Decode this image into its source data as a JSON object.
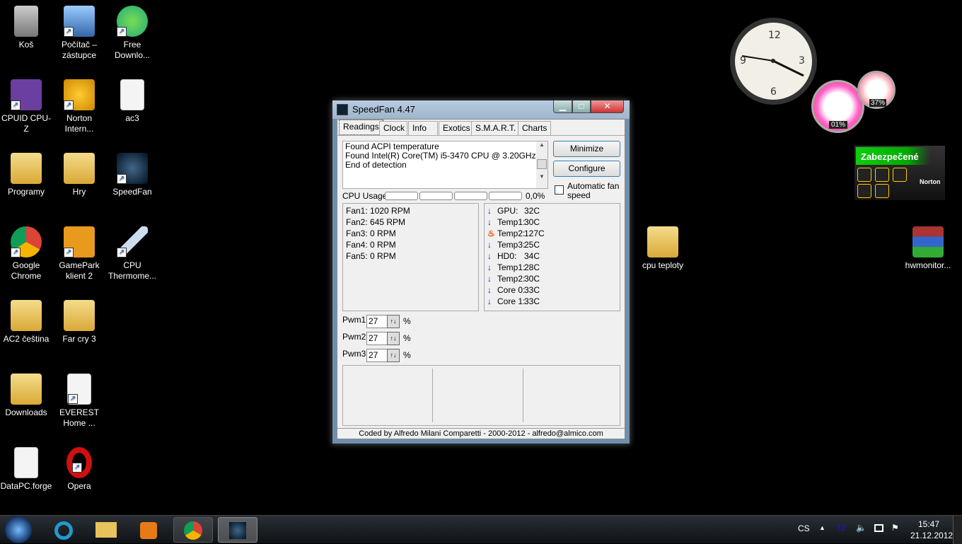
{
  "desktop_icons": [
    {
      "label": "Koš"
    },
    {
      "label": "Počítač – zástupce"
    },
    {
      "label": "Free Downlo..."
    },
    {
      "label": "CPUID CPU-Z"
    },
    {
      "label": "Norton Intern..."
    },
    {
      "label": "ac3"
    },
    {
      "label": "Programy"
    },
    {
      "label": "Hry"
    },
    {
      "label": "SpeedFan"
    },
    {
      "label": "Google Chrome"
    },
    {
      "label": "GamePark klient 2"
    },
    {
      "label": "CPU Thermome..."
    },
    {
      "label": "AC2 čeština"
    },
    {
      "label": "Far cry 3"
    },
    {
      "label": "Downloads"
    },
    {
      "label": "EVEREST Home ..."
    },
    {
      "label": "DataPC.forge"
    },
    {
      "label": "Opera"
    },
    {
      "label": "cpu teploty"
    },
    {
      "label": "hwmonitor..."
    }
  ],
  "gadgets": {
    "cpu_meter": {
      "cpu": "01%",
      "ram": "37%"
    },
    "norton": {
      "status": "Zabezpečené",
      "brand": "Norton"
    },
    "clock": {
      "hour": 15,
      "minute": 47
    }
  },
  "window": {
    "title": "SpeedFan 4.47",
    "tabs": [
      "Readings",
      "Clock",
      "Info",
      "Exotics",
      "S.M.A.R.T.",
      "Charts"
    ],
    "log": [
      "Found ACPI temperature",
      "Found Intel(R) Core(TM) i5-3470 CPU @ 3.20GHz",
      "End of detection"
    ],
    "minimize": "Minimize",
    "configure": "Configure",
    "auto_fan": "Automatic fan speed",
    "cpu_usage_label": "CPU Usage",
    "cpu_usage_value": "0,0%",
    "fans": [
      "Fan1: 1020 RPM",
      "Fan2: 645 RPM",
      "Fan3: 0 RPM",
      "Fan4: 0 RPM",
      "Fan5: 0 RPM"
    ],
    "temps": [
      {
        "name": "GPU:",
        "value": "32C",
        "icon": "down"
      },
      {
        "name": "Temp1:",
        "value": "30C",
        "icon": "down"
      },
      {
        "name": "Temp2:",
        "value": "127C",
        "icon": "fire"
      },
      {
        "name": "Temp3:",
        "value": "25C",
        "icon": "down"
      },
      {
        "name": "HD0:",
        "value": "34C",
        "icon": "down"
      },
      {
        "name": "Temp1:",
        "value": "28C",
        "icon": "down"
      },
      {
        "name": "Temp2:",
        "value": "30C",
        "icon": "down"
      },
      {
        "name": "Core 0:",
        "value": "33C",
        "icon": "down"
      },
      {
        "name": "Core 1:",
        "value": "33C",
        "icon": "down"
      }
    ],
    "pwm": [
      {
        "label": "Pwm1:",
        "value": "27"
      },
      {
        "label": "Pwm2:",
        "value": "27"
      },
      {
        "label": "Pwm3:",
        "value": "27"
      }
    ],
    "percent": "%",
    "footer": "Coded by Alfredo Milani Comparetti - 2000-2012 - alfredo@almico.com"
  },
  "tray": {
    "lang": "CS",
    "temp": "32",
    "time": "15:47",
    "date": "21.12.2012"
  }
}
